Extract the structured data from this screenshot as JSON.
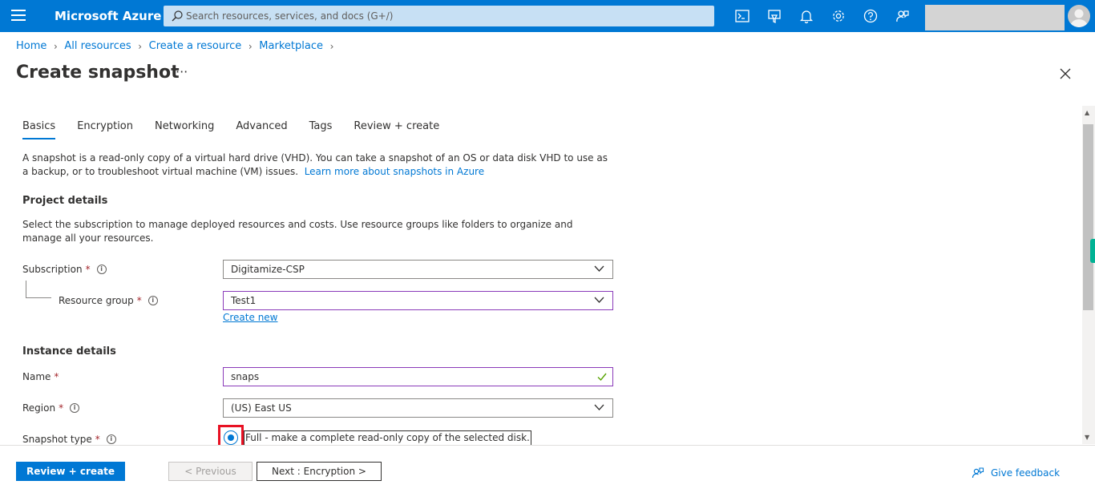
{
  "topbar": {
    "brand": "Microsoft Azure",
    "search_placeholder": "Search resources, services, and docs (G+/)",
    "icons": [
      "cloud-shell-icon",
      "directory-filter-icon",
      "notifications-icon",
      "settings-icon",
      "help-icon",
      "feedback-icon"
    ]
  },
  "breadcrumb": [
    "Home",
    "All resources",
    "Create a resource",
    "Marketplace"
  ],
  "page": {
    "title": "Create snapshot",
    "more": "···"
  },
  "tabs": [
    "Basics",
    "Encryption",
    "Networking",
    "Advanced",
    "Tags",
    "Review + create"
  ],
  "intro": {
    "text": "A snapshot is a read-only copy of a virtual hard drive (VHD). You can take a snapshot of an OS or data disk VHD to use as a backup, or to troubleshoot virtual machine (VM) issues.",
    "link": "Learn more about snapshots in Azure"
  },
  "project": {
    "heading": "Project details",
    "description": "Select the subscription to manage deployed resources and costs. Use resource groups like folders to organize and manage all your resources.",
    "subscription_label": "Subscription",
    "subscription_value": "Digitamize-CSP",
    "resource_group_label": "Resource group",
    "resource_group_value": "Test1",
    "create_new": "Create new"
  },
  "instance": {
    "heading": "Instance details",
    "name_label": "Name",
    "name_value": "snaps",
    "region_label": "Region",
    "region_value": "(US) East US",
    "snapshot_type_label": "Snapshot type",
    "snapshot_type_option": "Full - make a complete read-only copy of the selected disk."
  },
  "required_mark": "*",
  "footer": {
    "review_create": "Review + create",
    "previous": "< Previous",
    "next": "Next : Encryption >",
    "feedback": "Give feedback"
  },
  "colors": {
    "accent": "#0078d4",
    "highlight": "#e81123",
    "focus": "#8a3ab9"
  }
}
